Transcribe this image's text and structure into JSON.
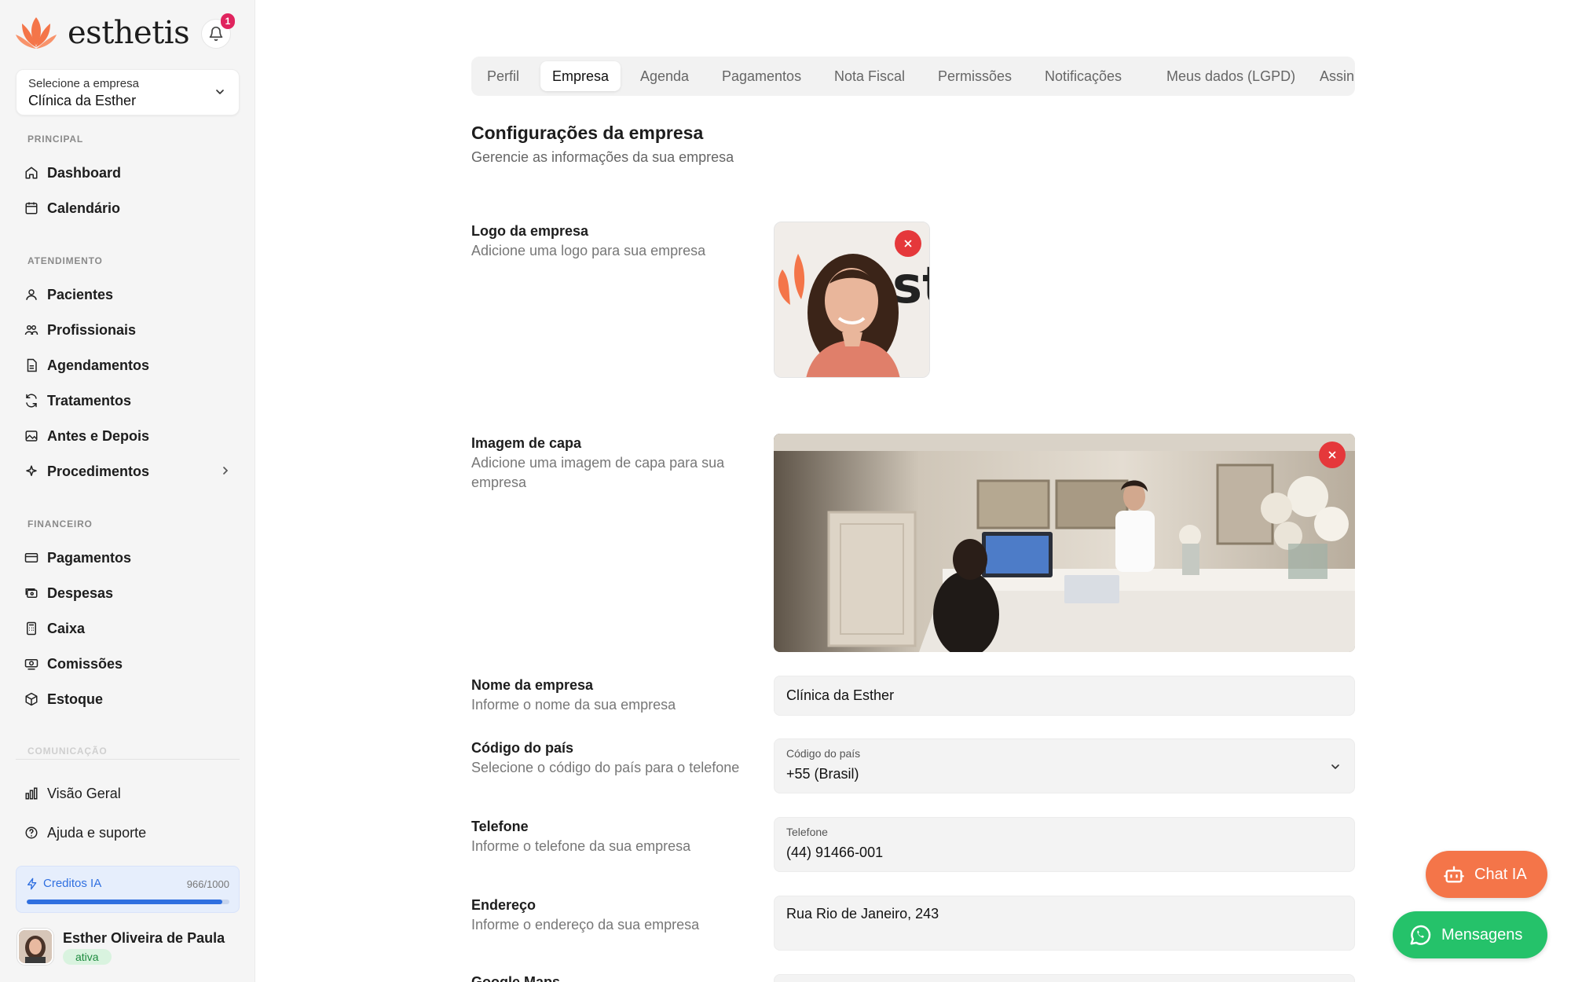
{
  "brand": {
    "name": "esthetis",
    "accent": "#f47549"
  },
  "notifications": {
    "count": "1"
  },
  "company_select": {
    "label": "Selecione a empresa",
    "value": "Clínica da Esther"
  },
  "sidebar": {
    "sections": [
      {
        "title": "PRINCIPAL",
        "items": [
          {
            "label": "Dashboard",
            "icon": "home-icon"
          },
          {
            "label": "Calendário",
            "icon": "calendar-icon"
          }
        ]
      },
      {
        "title": "ATENDIMENTO",
        "items": [
          {
            "label": "Pacientes",
            "icon": "user-icon"
          },
          {
            "label": "Profissionais",
            "icon": "users-icon"
          },
          {
            "label": "Agendamentos",
            "icon": "file-icon"
          },
          {
            "label": "Tratamentos",
            "icon": "refresh-icon"
          },
          {
            "label": "Antes e Depois",
            "icon": "image-icon"
          },
          {
            "label": "Procedimentos",
            "icon": "sparkles-icon"
          }
        ]
      },
      {
        "title": "FINANCEIRO",
        "items": [
          {
            "label": "Pagamentos",
            "icon": "credit-card-icon"
          },
          {
            "label": "Despesas",
            "icon": "receipt-icon"
          },
          {
            "label": "Caixa",
            "icon": "calculator-icon"
          },
          {
            "label": "Comissões",
            "icon": "banknote-icon"
          },
          {
            "label": "Estoque",
            "icon": "box-icon"
          }
        ]
      },
      {
        "title": "COMUNICAÇÃO"
      }
    ],
    "footer_items": [
      {
        "label": "Visão Geral",
        "icon": "chart-icon"
      },
      {
        "label": "Ajuda e suporte",
        "icon": "help-icon"
      }
    ],
    "credits": {
      "label": "Creditos IA",
      "value": "966/1000",
      "fraction": 0.966
    },
    "user": {
      "name": "Esther Oliveira de Paula",
      "status": "ativa"
    }
  },
  "tabs": [
    "Perfil",
    "Empresa",
    "Agenda",
    "Pagamentos",
    "Nota Fiscal",
    "Permissões",
    "Notificações",
    "Meus dados (LGPD)",
    "Assin"
  ],
  "active_tab": "Empresa",
  "page": {
    "title": "Configurações da empresa",
    "subtitle": "Gerencie as informações da sua empresa"
  },
  "fields": {
    "logo": {
      "label": "Logo da empresa",
      "desc": "Adicione uma logo para sua empresa"
    },
    "cover": {
      "label": "Imagem de capa",
      "desc": "Adicione uma imagem de capa para sua empresa"
    },
    "name": {
      "label": "Nome da empresa",
      "desc": "Informe o nome da sua empresa",
      "value": "Clínica da Esther"
    },
    "country_code": {
      "label": "Código do país",
      "desc": "Selecione o código do país para o telefone",
      "field_label": "Código do país",
      "value": "+55 (Brasil)"
    },
    "phone": {
      "label": "Telefone",
      "desc": "Informe o telefone da sua empresa",
      "field_label": "Telefone",
      "value": "(44) 91466-001"
    },
    "address": {
      "label": "Endereço",
      "desc": "Informe o endereço da sua empresa",
      "value": "Rua Rio de Janeiro, 243"
    },
    "maps": {
      "label": "Google Maps"
    }
  },
  "fab": {
    "chat": "Chat IA",
    "messages": "Mensagens"
  }
}
